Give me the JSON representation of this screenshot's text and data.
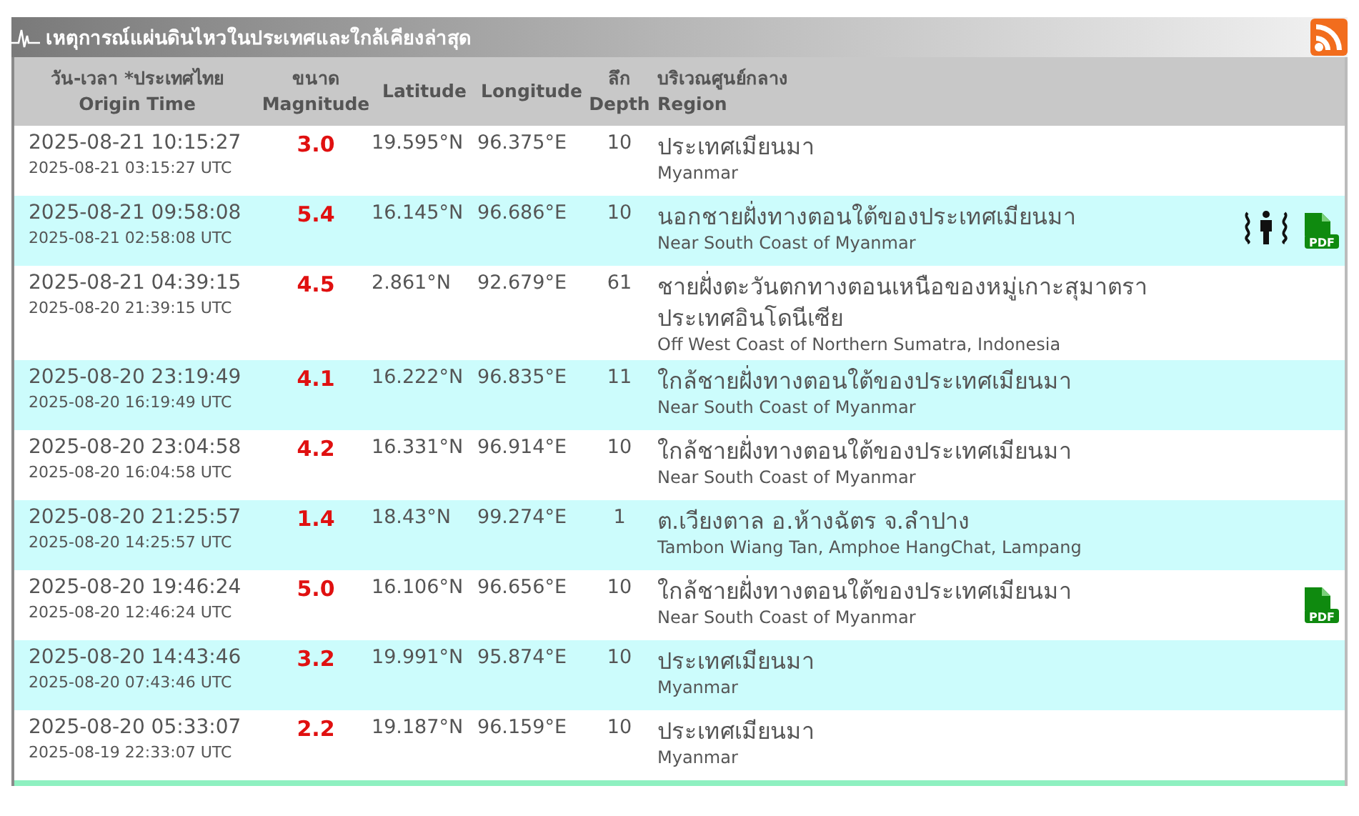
{
  "panel": {
    "title": "เหตุการณ์แผ่นดินไหวในประเทศและใกล้เคียงล่าสุด"
  },
  "table": {
    "columns": [
      {
        "th": "วัน-เวลา *ประเทศไทย",
        "en": "Origin Time"
      },
      {
        "th": "ขนาด",
        "en": "Magnitude"
      },
      {
        "en": "Latitude"
      },
      {
        "en": "Longitude"
      },
      {
        "th": "ลึก",
        "en": "Depth"
      },
      {
        "th": "บริเวณศูนย์กลาง",
        "en": "Region"
      }
    ],
    "rows": [
      {
        "time": "2025-08-21 10:15:27",
        "utc": "2025-08-21 03:15:27 UTC",
        "magnitude": "3.0",
        "latitude": "19.595°N",
        "longitude": "96.375°E",
        "depth": "10",
        "region_th": [
          "ประเทศเมียนมา"
        ],
        "region_en": "Myanmar",
        "felt_report": false,
        "pdf": false
      },
      {
        "time": "2025-08-21 09:58:08",
        "utc": "2025-08-21 02:58:08 UTC",
        "magnitude": "5.4",
        "latitude": "16.145°N",
        "longitude": "96.686°E",
        "depth": "10",
        "region_th": [
          "นอกชายฝั่งทางตอนใต้ของประเทศเมียนมา"
        ],
        "region_en": "Near South Coast of Myanmar",
        "felt_report": true,
        "pdf": true,
        "pdf_label": "PDF"
      },
      {
        "time": "2025-08-21 04:39:15",
        "utc": "2025-08-20 21:39:15 UTC",
        "magnitude": "4.5",
        "latitude": "2.861°N",
        "longitude": "92.679°E",
        "depth": "61",
        "region_th": [
          "ชายฝั่งตะวันตกทางตอนเหนือของหมู่เกาะสุมาตรา",
          "ประเทศอินโดนีเซีย"
        ],
        "region_en": "Off West Coast of Northern Sumatra, Indonesia",
        "felt_report": false,
        "pdf": false
      },
      {
        "time": "2025-08-20 23:19:49",
        "utc": "2025-08-20 16:19:49 UTC",
        "magnitude": "4.1",
        "latitude": "16.222°N",
        "longitude": "96.835°E",
        "depth": "11",
        "region_th": [
          "ใกล้ชายฝั่งทางตอนใต้ของประเทศเมียนมา"
        ],
        "region_en": "Near South Coast of Myanmar",
        "felt_report": false,
        "pdf": false
      },
      {
        "time": "2025-08-20 23:04:58",
        "utc": "2025-08-20 16:04:58 UTC",
        "magnitude": "4.2",
        "latitude": "16.331°N",
        "longitude": "96.914°E",
        "depth": "10",
        "region_th": [
          "ใกล้ชายฝั่งทางตอนใต้ของประเทศเมียนมา"
        ],
        "region_en": "Near South Coast of Myanmar",
        "felt_report": false,
        "pdf": false
      },
      {
        "time": "2025-08-20 21:25:57",
        "utc": "2025-08-20 14:25:57 UTC",
        "magnitude": "1.4",
        "latitude": "18.43°N",
        "longitude": "99.274°E",
        "depth": "1",
        "region_th": [
          "ต.เวียงตาล อ.ห้างฉัตร จ.ลำปาง"
        ],
        "region_en": "Tambon Wiang Tan, Amphoe HangChat, Lampang",
        "felt_report": false,
        "pdf": false
      },
      {
        "time": "2025-08-20 19:46:24",
        "utc": "2025-08-20 12:46:24 UTC",
        "magnitude": "5.0",
        "latitude": "16.106°N",
        "longitude": "96.656°E",
        "depth": "10",
        "region_th": [
          "ใกล้ชายฝั่งทางตอนใต้ของประเทศเมียนมา"
        ],
        "region_en": "Near South Coast of Myanmar",
        "felt_report": false,
        "pdf": true,
        "pdf_label": "PDF"
      },
      {
        "time": "2025-08-20 14:43:46",
        "utc": "2025-08-20 07:43:46 UTC",
        "magnitude": "3.2",
        "latitude": "19.991°N",
        "longitude": "95.874°E",
        "depth": "10",
        "region_th": [
          "ประเทศเมียนมา"
        ],
        "region_en": "Myanmar",
        "felt_report": false,
        "pdf": false
      },
      {
        "time": "2025-08-20 05:33:07",
        "utc": "2025-08-19 22:33:07 UTC",
        "magnitude": "2.2",
        "latitude": "19.187°N",
        "longitude": "96.159°E",
        "depth": "10",
        "region_th": [
          "ประเทศเมียนมา"
        ],
        "region_en": "Myanmar",
        "felt_report": false,
        "pdf": false
      }
    ]
  }
}
